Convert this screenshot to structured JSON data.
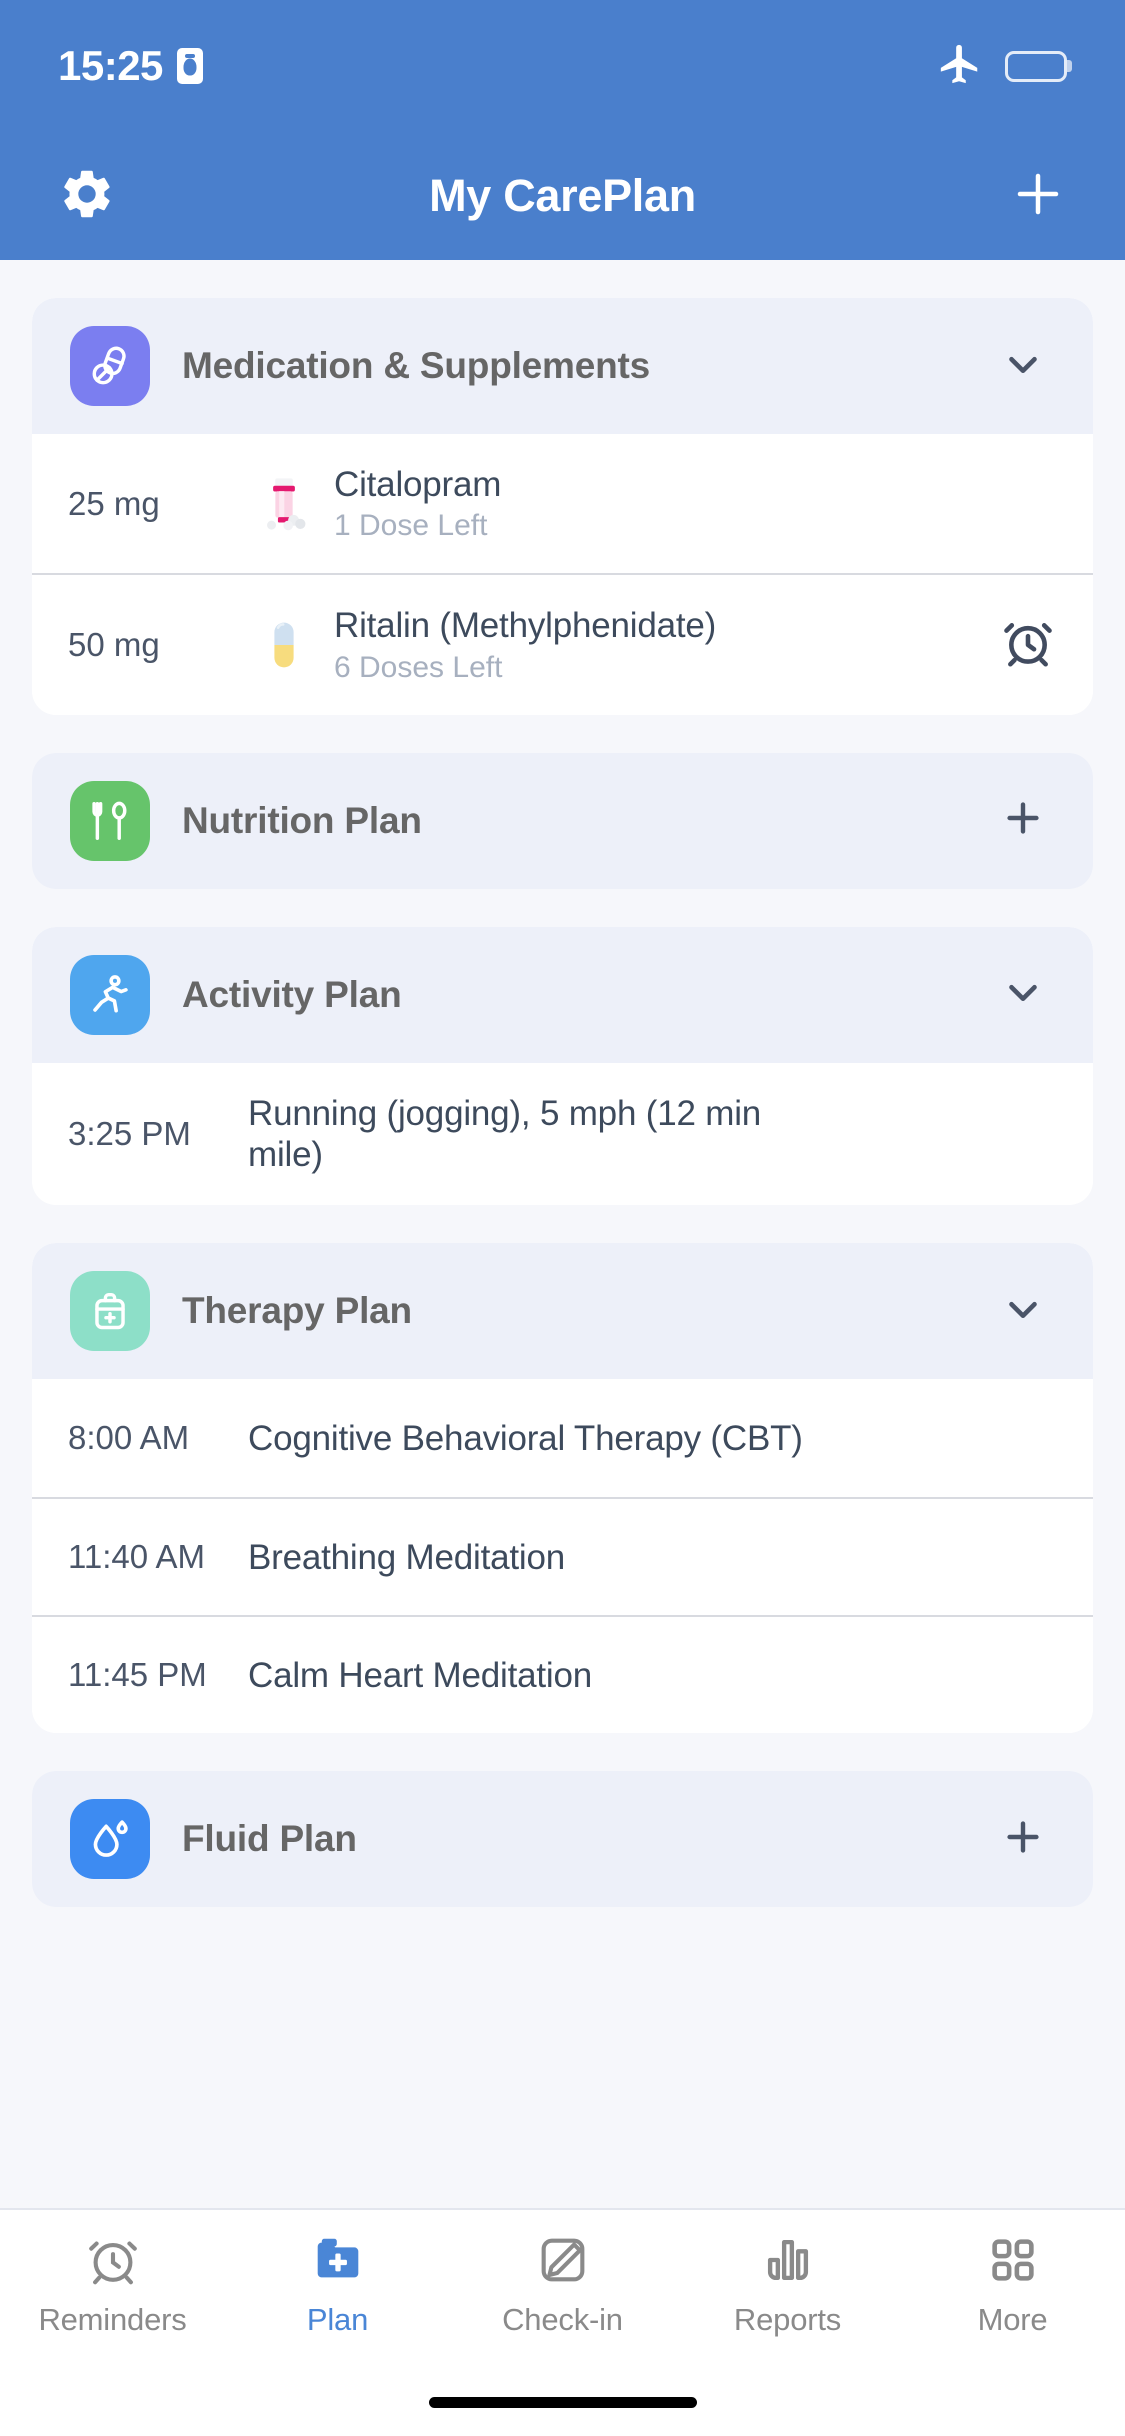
{
  "status_bar": {
    "time": "15:25",
    "recording_icon": "recording-indicator-icon",
    "airplane_icon": "airplane-mode-icon",
    "battery_icon": "battery-full-icon"
  },
  "nav": {
    "title": "My CarePlan",
    "settings_icon": "gear-icon",
    "add_icon": "plus-icon"
  },
  "colors": {
    "header_blue": "#4a7fcc",
    "page_bg": "#f6f7fb",
    "section_header_bg": "#edf0f9",
    "medication_icon": "#7b7ef0",
    "nutrition_icon": "#66c46b",
    "activity_icon": "#4fa6ee",
    "therapy_icon": "#8ddfc8",
    "fluid_icon": "#3d8bf2",
    "active_tab": "#4a86d6",
    "inactive_tab": "#8a8a8a",
    "row_text": "#3d4a5c",
    "row_sub_text": "#a7b0bf"
  },
  "sections": [
    {
      "id": "medication",
      "title": "Medication & Supplements",
      "icon": "pills-icon",
      "icon_color": "#7b7ef0",
      "action": "chevron-down-icon",
      "expanded": true,
      "rows": [
        {
          "time": "25 mg",
          "icon": "pill-bottle-icon",
          "title": "Citalopram",
          "subtitle": "1 Dose Left",
          "trailing_icon": ""
        },
        {
          "time": "50 mg",
          "icon": "capsule-icon",
          "title": "Ritalin (Methylphenidate)",
          "subtitle": "6 Doses Left",
          "trailing_icon": "alarm-clock-icon"
        }
      ]
    },
    {
      "id": "nutrition",
      "title": "Nutrition Plan",
      "icon": "cutlery-icon",
      "icon_color": "#66c46b",
      "action": "plus-icon",
      "expanded": false,
      "rows": []
    },
    {
      "id": "activity",
      "title": "Activity Plan",
      "icon": "running-icon",
      "icon_color": "#4fa6ee",
      "action": "chevron-down-icon",
      "expanded": true,
      "rows": [
        {
          "time": "3:25 PM",
          "icon": "",
          "title": "Running (jogging), 5 mph (12 min mile)",
          "subtitle": "",
          "trailing_icon": ""
        }
      ]
    },
    {
      "id": "therapy",
      "title": "Therapy Plan",
      "icon": "medical-kit-icon",
      "icon_color": "#8ddfc8",
      "action": "chevron-down-icon",
      "expanded": true,
      "rows": [
        {
          "time": "8:00 AM",
          "icon": "",
          "title": "Cognitive Behavioral Therapy (CBT)",
          "subtitle": "",
          "trailing_icon": ""
        },
        {
          "time": "11:40 AM",
          "icon": "",
          "title": "Breathing Meditation",
          "subtitle": "",
          "trailing_icon": ""
        },
        {
          "time": "11:45 PM",
          "icon": "",
          "title": "Calm Heart Meditation",
          "subtitle": "",
          "trailing_icon": ""
        }
      ]
    },
    {
      "id": "fluid",
      "title": "Fluid Plan",
      "icon": "water-drop-icon",
      "icon_color": "#3d8bf2",
      "action": "plus-icon",
      "expanded": false,
      "rows": []
    }
  ],
  "tabs": [
    {
      "label": "Reminders",
      "icon": "alarm-clock-icon",
      "active": false
    },
    {
      "label": "Plan",
      "icon": "folder-plus-icon",
      "active": true
    },
    {
      "label": "Check-in",
      "icon": "edit-square-icon",
      "active": false
    },
    {
      "label": "Reports",
      "icon": "bar-chart-icon",
      "active": false
    },
    {
      "label": "More",
      "icon": "grid-icon",
      "active": false
    }
  ]
}
